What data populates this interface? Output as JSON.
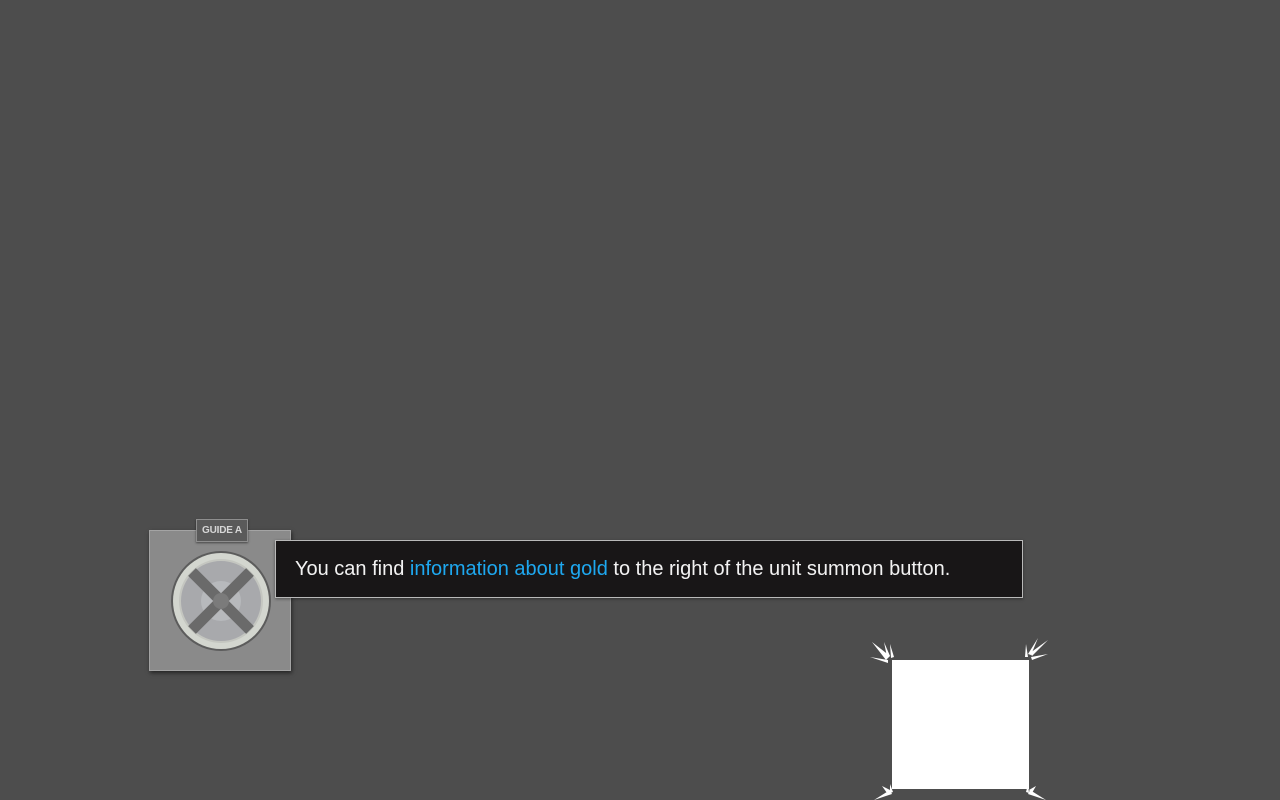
{
  "guide": {
    "tag_label": "GUIDE A",
    "avatar_icon": "crossed-wheel-icon"
  },
  "dialog": {
    "text_before": "You can find ",
    "text_highlight": "information about gold",
    "text_after": " to the right of the unit summon button.",
    "highlight_color": "#1ea8f0"
  },
  "focus": {
    "fill_color": "#ffffff",
    "marker_icon": "corner-burst-icon"
  },
  "colors": {
    "background": "#4d4d4d",
    "dialog_background": "#181617",
    "card_background": "#8a8a8a"
  }
}
